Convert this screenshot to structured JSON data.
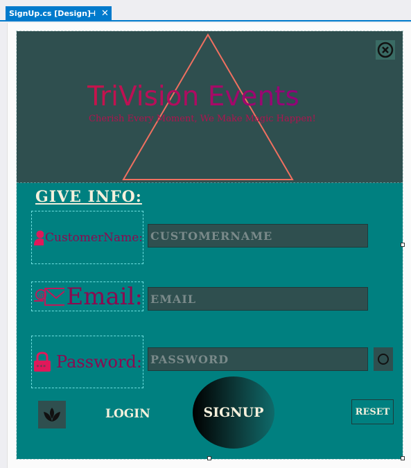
{
  "ide": {
    "tab_label": "SignUp.cs [Design]",
    "pin_glyph": "⊣",
    "close_glyph": "✕"
  },
  "header": {
    "title": "TriVision Events",
    "tagline": "Cherish Every Moment, We Make Magic Happen!",
    "close_icon": "circle-x-icon"
  },
  "form": {
    "section_title": "GIVE INFO:",
    "fields": [
      {
        "label": "CustomerName:",
        "placeholder": "CUSTOMERNAME",
        "icon": "user-icon"
      },
      {
        "label": "Email:",
        "placeholder": "EMAIL",
        "icon": "email-icon"
      },
      {
        "label": "Password:",
        "placeholder": "PASSWORD",
        "icon": "lock-icon"
      }
    ],
    "show_password_icon": "eye-circle-icon"
  },
  "footer": {
    "logo_icon": "lotus-icon",
    "login_label": "LOGIN",
    "signup_label": "SIGNUP",
    "reset_label": "RESET"
  },
  "colors": {
    "form_bg": "#008080",
    "header_bg": "#2f4f4f",
    "accent_magenta": "#c71585",
    "triangle": "#f07060",
    "label_text": "#8b0a50",
    "button_text": "#f5f0dc"
  }
}
